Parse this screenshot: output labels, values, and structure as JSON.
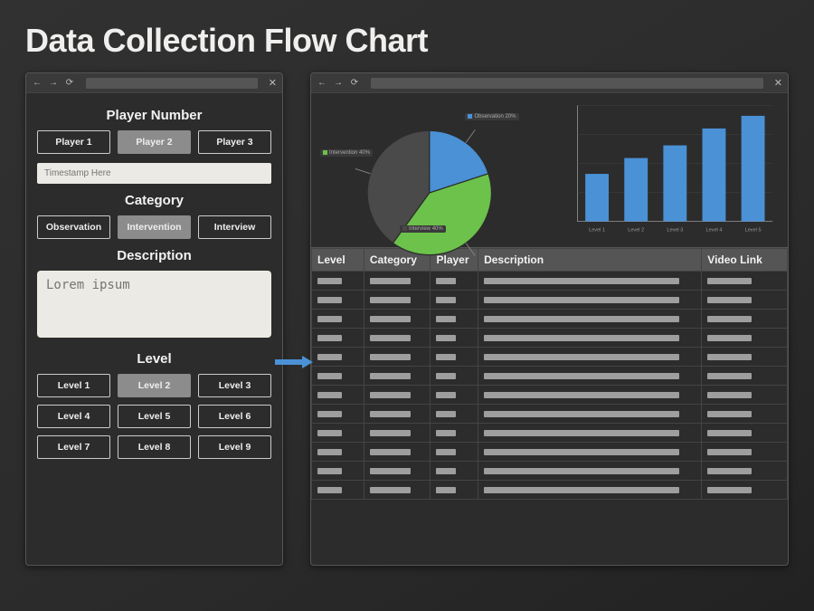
{
  "title": "Data Collection Flow Chart",
  "form": {
    "player_heading": "Player Number",
    "players": [
      "Player 1",
      "Player 2",
      "Player 3"
    ],
    "player_selected_index": 1,
    "timestamp_placeholder": "Timestamp Here",
    "category_heading": "Category",
    "categories": [
      "Observation",
      "Intervention",
      "Interview"
    ],
    "category_selected_index": 1,
    "description_heading": "Description",
    "description_placeholder": "Lorem ipsum",
    "level_heading": "Level",
    "levels": [
      "Level 1",
      "Level 2",
      "Level 3",
      "Level 4",
      "Level 5",
      "Level 6",
      "Level 7",
      "Level 8",
      "Level 9"
    ],
    "level_selected_index": 1
  },
  "dashboard": {
    "table": {
      "columns": [
        "Level",
        "Category",
        "Player",
        "Description",
        "Video Link"
      ],
      "row_count": 12
    }
  },
  "chart_data": [
    {
      "type": "pie",
      "series": [
        {
          "name": "Observation",
          "value": 20,
          "color": "#4a91d6"
        },
        {
          "name": "Intervention",
          "value": 40,
          "color": "#6cc24a"
        },
        {
          "name": "Interview",
          "value": 40,
          "color": "#4a4a4a"
        }
      ],
      "legend_position": "outside"
    },
    {
      "type": "bar",
      "categories": [
        "Level 1",
        "Level 2",
        "Level 3",
        "Level 4",
        "Level 5"
      ],
      "values": [
        45,
        60,
        72,
        88,
        100
      ],
      "ylim": [
        0,
        110
      ],
      "color": "#4a91d6",
      "xlabel": "",
      "ylabel": ""
    }
  ]
}
